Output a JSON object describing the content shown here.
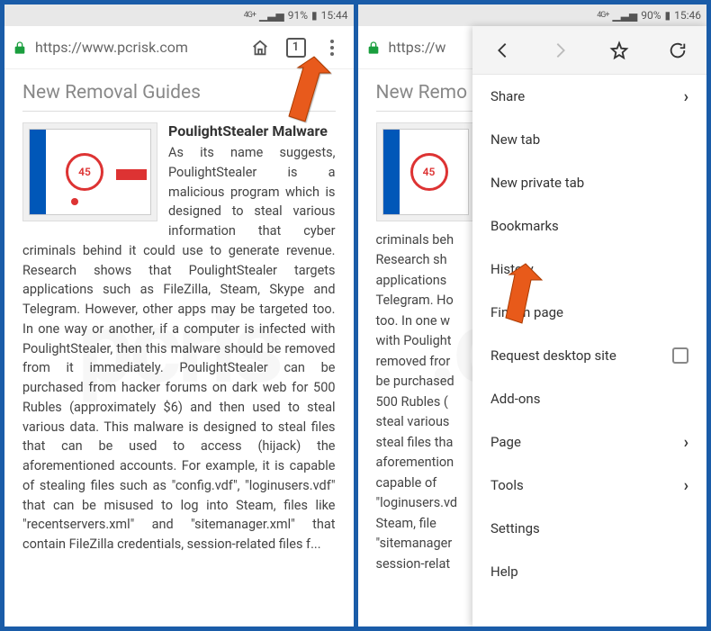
{
  "left": {
    "status": {
      "network": "4G+",
      "signal": "▁▃▅",
      "battery_pct": "91%",
      "time": "15:44"
    },
    "url": "https://www.pcrisk.com",
    "tab_count": "1",
    "section_title": "New Removal Guides",
    "article_title": "PoulightStealer Malware",
    "thumb_num": "45",
    "article_body": "As its name suggests, PoulightStealer is a malicious program which is designed to steal various information that cyber criminals behind it could use to generate revenue. Research shows that PoulightStealer targets applications such as FileZilla, Steam, Skype and Telegram. However, other apps may be targeted too. In one way or another, if a computer is infected with PoulightStealer, then this malware should be removed from it immediately. PoulightStealer can be purchased from hacker forums on dark web for 500 Rubles (approximately $6) and then used to steal various data. This malware is designed to steal files that can be used to access (hijack) the aforementioned accounts. For example, it is capable of stealing files such as \"config.vdf\", \"loginusers.vdf\" that can be misused to log into Steam, files like \"recentservers.xml\" and \"sitemanager.xml\" that contain FileZilla credentials, session-related files f..."
  },
  "right": {
    "status": {
      "network": "4G+",
      "signal": "▁▃▅",
      "battery_pct": "90%",
      "time": "15:46"
    },
    "url_trunc": "https://w",
    "section_title": "New Remo",
    "thumb_num": "45",
    "body_left": "criminals beh\nResearch sh\napplications\nTelegram. Ho\ntoo. In one w\nwith Poulight\nremoved fror\nbe purchased\n500 Rubles (\nsteal various\nsteal files tha\naforemention\ncapable of\n\"loginusers.vd\nSteam, file\n\"sitemanager\nsession-relat",
    "menu": {
      "items": [
        {
          "label": "Share",
          "arrow": true
        },
        {
          "label": "New tab"
        },
        {
          "label": "New private tab"
        },
        {
          "label": "Bookmarks"
        },
        {
          "label": "History"
        },
        {
          "label": "Find in page"
        },
        {
          "label": "Request desktop site",
          "checkbox": true
        },
        {
          "label": "Add-ons"
        },
        {
          "label": "Page",
          "arrow": true
        },
        {
          "label": "Tools",
          "arrow": true
        },
        {
          "label": "Settings"
        },
        {
          "label": "Help"
        }
      ]
    }
  },
  "icons": {
    "lock": "lock-icon",
    "home": "home-icon",
    "tabs": "tabs-icon",
    "dots": "menu-icon",
    "back": "back-icon",
    "forward": "forward-icon",
    "star": "star-icon",
    "reload": "reload-icon"
  },
  "watermark": ".com"
}
